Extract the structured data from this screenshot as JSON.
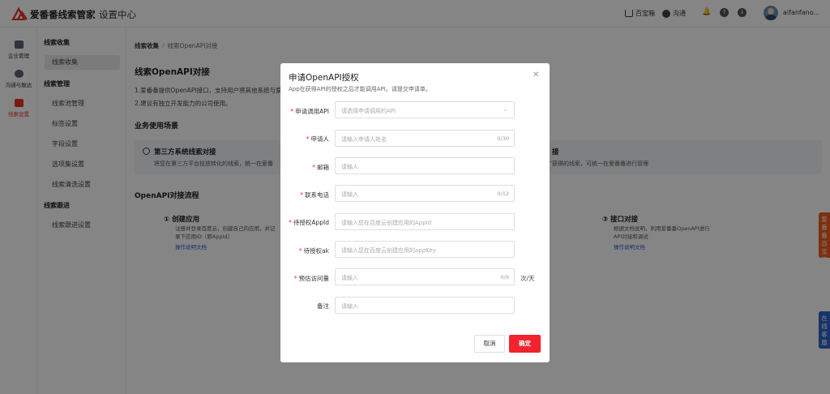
{
  "header": {
    "brand": "爱番番线索管家",
    "subtitle": "设置中心",
    "treasure_box": "百宝箱",
    "chat": "沟通",
    "username": "aifanfano..."
  },
  "rail": {
    "items": [
      {
        "label": "企业管理",
        "icon": "building-icon"
      },
      {
        "label": "沟通与触达",
        "icon": "chat-icon"
      },
      {
        "label": "线索设置",
        "icon": "list-icon"
      }
    ]
  },
  "subnav": {
    "groups": [
      {
        "title": "线索收集",
        "items": [
          "线索收集"
        ]
      },
      {
        "title": "线索管理",
        "items": [
          "线索池管理",
          "标签设置",
          "字段设置",
          "选项集设置",
          "线索清洗设置"
        ]
      },
      {
        "title": "线索跟进",
        "items": [
          "线索跟进设置"
        ]
      }
    ]
  },
  "main": {
    "breadcrumb": {
      "root": "线索收集",
      "current": "线索OpenAPI对接"
    },
    "title": "线索OpenAPI对接",
    "desc1": "1.爱番番提供OpenAPI接口，支持用户将其他系统与爱",
    "desc2": "2.建议有独立开发能力的公司使用。",
    "scene_title": "业务使用场景",
    "scene1_title": "第三方系统线索对接",
    "scene1_desc": "将您在第三方平台投放转化的线索，统一在爱番",
    "scene2_title": "接",
    "scene2_desc": "推广获得的线索，可统一在爱番番进行管理",
    "flow_title": "OpenAPI对接流程",
    "flow1_title": "① 创建应用",
    "flow1_desc1": "注册并登录百度云，创建自己的应用，并记",
    "flow1_desc2": "录下应用ID（即AppId）",
    "flow1_link": "操作说明文档",
    "flow3_title": "③ 接口对接",
    "flow3_desc1": "根据文档说明，利用爱番番OpenAPI进行",
    "flow3_desc2": "API对接和调试",
    "flow3_link": "操作说明文档"
  },
  "side_tabs": {
    "treasure": "爱番番百宝箱",
    "service": "在线客服"
  },
  "modal": {
    "title": "申请OpenAPI授权",
    "subtitle": "App在获得API的授权之后才能调用API。请提交申请单。",
    "fields": [
      {
        "label": "申请调用API",
        "required": true,
        "placeholder": "请选择申请调用的API",
        "counter": "",
        "kind": "select"
      },
      {
        "label": "申请人",
        "required": true,
        "placeholder": "请输入申请人姓名",
        "counter": "0/30",
        "kind": "text"
      },
      {
        "label": "邮箱",
        "required": true,
        "placeholder": "请输入",
        "counter": "",
        "kind": "text"
      },
      {
        "label": "联系电话",
        "required": true,
        "placeholder": "请输入",
        "counter": "0/12",
        "kind": "text"
      },
      {
        "label": "待授权AppId",
        "required": true,
        "placeholder": "请输入您在百度云创建应用的AppId",
        "counter": "",
        "kind": "text"
      },
      {
        "label": "待授权ak",
        "required": true,
        "placeholder": "请输入您在百度云创建应用的appKey",
        "counter": "",
        "kind": "text"
      },
      {
        "label": "预估访问量",
        "required": true,
        "placeholder": "请输入",
        "counter": "0/9",
        "kind": "text",
        "unit": "次/天"
      },
      {
        "label": "备注",
        "required": false,
        "placeholder": "请输入",
        "counter": "",
        "kind": "text"
      }
    ],
    "cancel": "取消",
    "confirm": "确定"
  },
  "colors": {
    "accent": "#f0232e",
    "link": "#2e5bd6",
    "overlay": "rgba(0,0,0,0.48)"
  }
}
